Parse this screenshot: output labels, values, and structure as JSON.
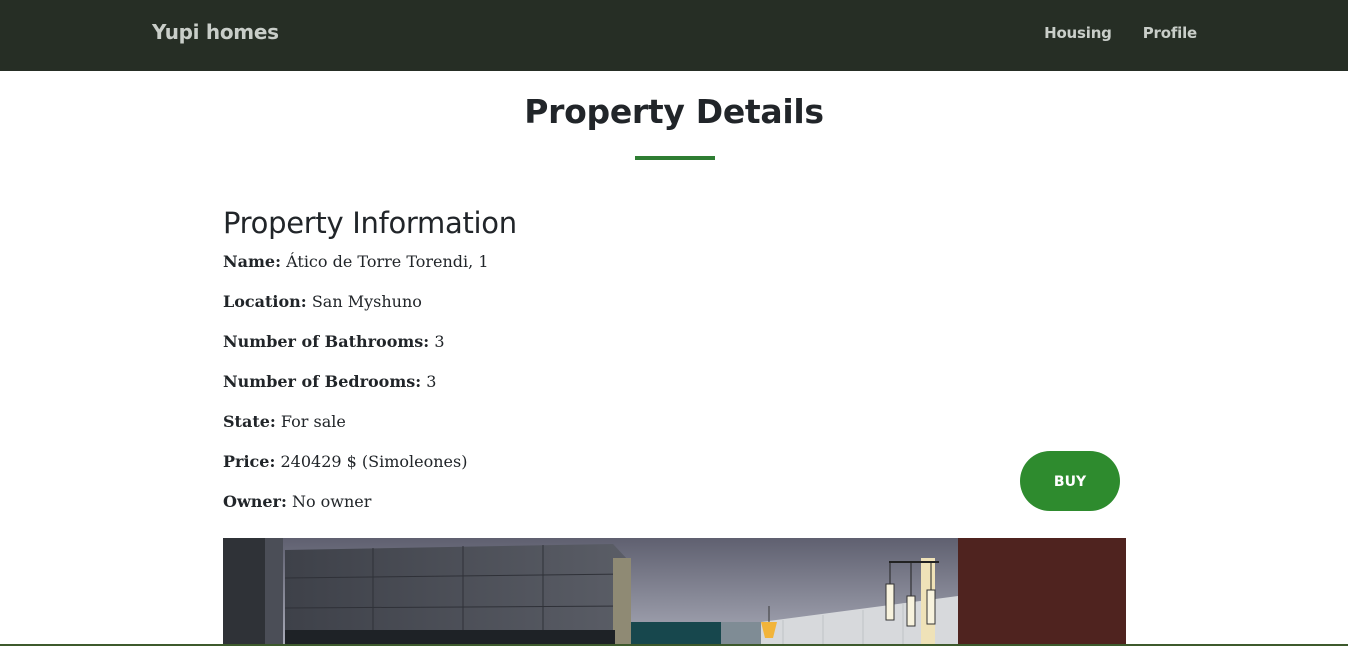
{
  "navbar": {
    "brand": "Yupi homes",
    "links": [
      "Housing",
      "Profile"
    ]
  },
  "page": {
    "title": "Property Details"
  },
  "property": {
    "section_title": "Property Information",
    "fields": [
      {
        "label": "Name:",
        "value": "Ático de Torre Torendi, 1"
      },
      {
        "label": "Location:",
        "value": "San Myshuno"
      },
      {
        "label": "Number of Bathrooms:",
        "value": "3"
      },
      {
        "label": "Number of Bedrooms:",
        "value": "3"
      },
      {
        "label": "State:",
        "value": "For sale"
      },
      {
        "label": "Price:",
        "value": "240429 $ (Simoleones)"
      },
      {
        "label": "Owner:",
        "value": "No owner"
      }
    ],
    "buy_label": "BUY"
  },
  "colors": {
    "navbar_bg": "#262e25",
    "accent": "#2e8b2e",
    "divider": "#2e7d32"
  }
}
